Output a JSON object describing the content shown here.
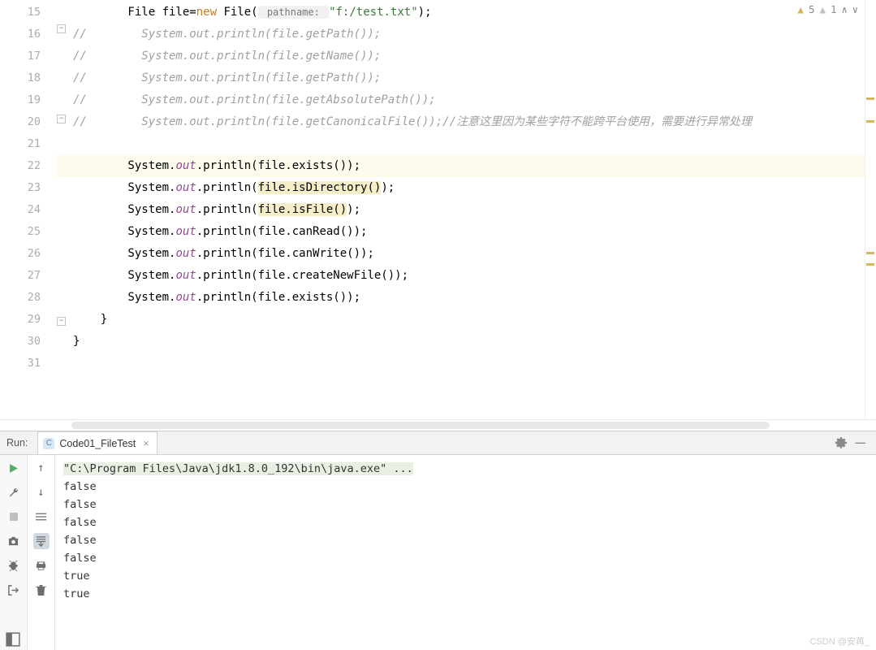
{
  "inspection": {
    "warning_count": "5",
    "weak_warning_count": "1"
  },
  "editor": {
    "lines": [
      {
        "n": 15,
        "type": "code",
        "indent": "        ",
        "prefix": "File file=",
        "kw": "new",
        "rest": " File(",
        "hint": " pathname: ",
        "str": "\"f:/test.txt\"",
        "tail": ");"
      },
      {
        "n": 16,
        "type": "comment",
        "text": "//        System.out.println(file.getPath());"
      },
      {
        "n": 17,
        "type": "comment",
        "text": "//        System.out.println(file.getName());"
      },
      {
        "n": 18,
        "type": "comment",
        "text": "//        System.out.println(file.getPath());"
      },
      {
        "n": 19,
        "type": "comment",
        "text": "//        System.out.println(file.getAbsolutePath());"
      },
      {
        "n": 20,
        "type": "comment",
        "text": "//        System.out.println(file.getCanonicalFile());//注意这里因为某些字符不能跨平台使用，需要进行异常处理"
      },
      {
        "n": 21,
        "type": "blank",
        "text": ""
      },
      {
        "n": 22,
        "type": "stmt-hl",
        "pre": "        System.",
        "field": "out",
        "mid": ".println(file.exists());"
      },
      {
        "n": 23,
        "type": "stmt-usage",
        "pre": "        System.",
        "field": "out",
        "mid": ".println(",
        "usage": "file.isDirectory()",
        "post": ");"
      },
      {
        "n": 24,
        "type": "stmt-usage",
        "pre": "        System.",
        "field": "out",
        "mid": ".println(",
        "usage": "file.isFile()",
        "post": ");"
      },
      {
        "n": 25,
        "type": "stmt",
        "pre": "        System.",
        "field": "out",
        "mid": ".println(file.canRead());"
      },
      {
        "n": 26,
        "type": "stmt",
        "pre": "        System.",
        "field": "out",
        "mid": ".println(file.canWrite());"
      },
      {
        "n": 27,
        "type": "stmt",
        "pre": "        System.",
        "field": "out",
        "mid": ".println(file.createNewFile());"
      },
      {
        "n": 28,
        "type": "stmt",
        "pre": "        System.",
        "field": "out",
        "mid": ".println(file.exists());"
      },
      {
        "n": 29,
        "type": "brace",
        "text": "    }"
      },
      {
        "n": 30,
        "type": "brace",
        "text": "}"
      },
      {
        "n": 31,
        "type": "blank",
        "text": ""
      }
    ]
  },
  "run": {
    "label": "Run:",
    "tab_name": "Code01_FileTest",
    "output": {
      "command": "\"C:\\Program Files\\Java\\jdk1.8.0_192\\bin\\java.exe\" ...",
      "lines": [
        "false",
        "false",
        "false",
        "false",
        "false",
        "true",
        "true"
      ]
    }
  },
  "watermark": "CSDN @安苒_"
}
